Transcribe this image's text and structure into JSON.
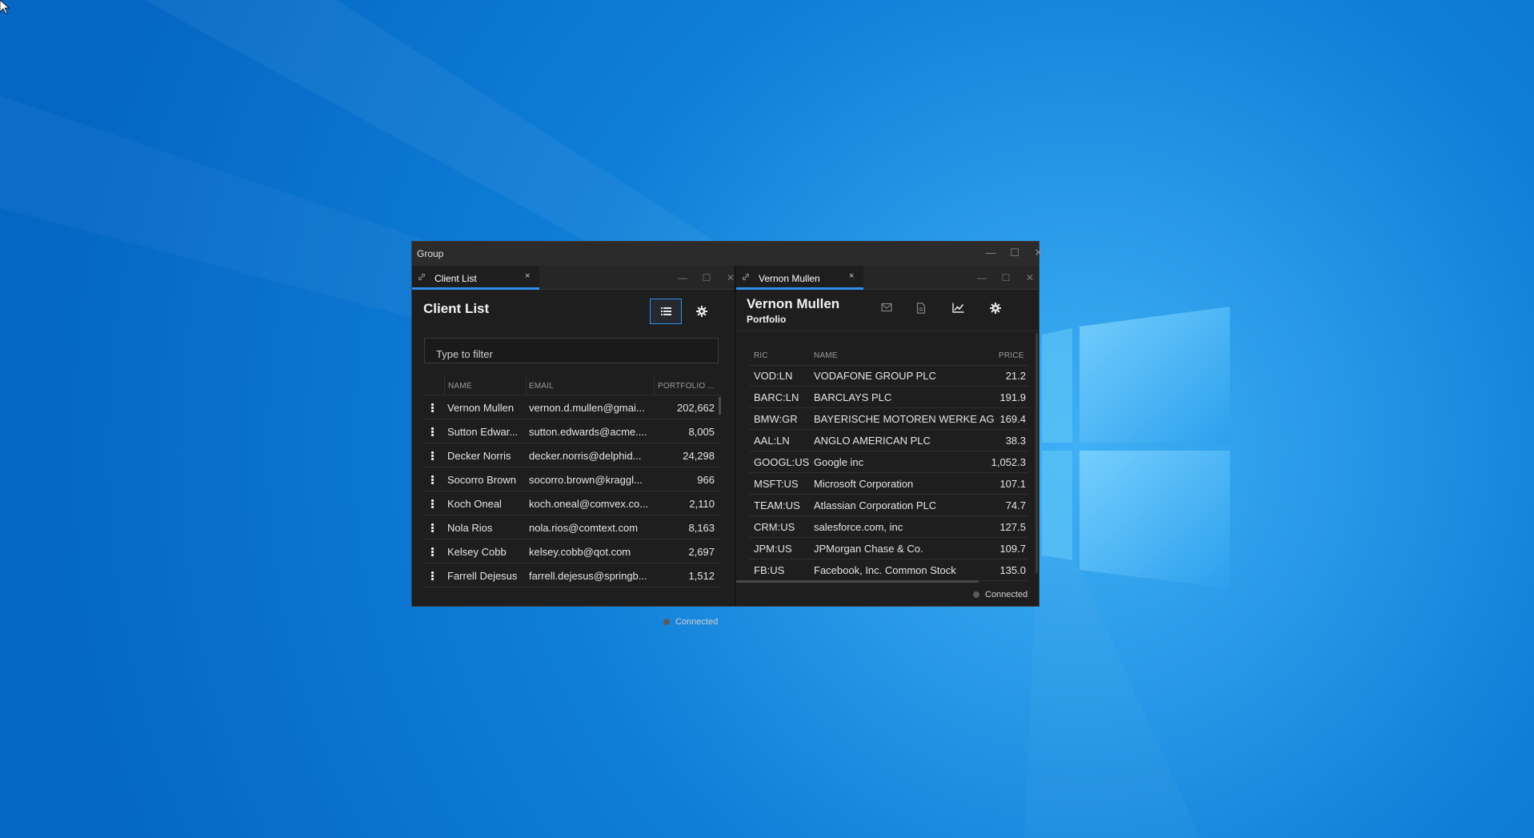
{
  "group_window": {
    "title": "Group",
    "controls": {
      "minimize": "—",
      "maximize": "☐",
      "close": "✕"
    }
  },
  "client_list": {
    "tab": {
      "label": "Client List",
      "close": "×"
    },
    "title": "Client List",
    "filter": {
      "value": "",
      "placeholder": "Type to filter"
    },
    "columns": [
      "NAME",
      "EMAIL",
      "PORTFOLIO ..."
    ],
    "rows": [
      {
        "name": "Vernon Mullen",
        "email": "vernon.d.mullen@gmai...",
        "portfolio": "202,662"
      },
      {
        "name": "Sutton Edwar...",
        "email": "sutton.edwards@acme....",
        "portfolio": "8,005"
      },
      {
        "name": "Decker Norris",
        "email": "decker.norris@delphid...",
        "portfolio": "24,298"
      },
      {
        "name": "Socorro Brown",
        "email": "socorro.brown@kraggl...",
        "portfolio": "966"
      },
      {
        "name": "Koch Oneal",
        "email": "koch.oneal@comvex.co...",
        "portfolio": "2,110"
      },
      {
        "name": "Nola Rios",
        "email": "nola.rios@comtext.com",
        "portfolio": "8,163"
      },
      {
        "name": "Kelsey Cobb",
        "email": "kelsey.cobb@qot.com",
        "portfolio": "2,697"
      },
      {
        "name": "Farrell Dejesus",
        "email": "farrell.dejesus@springb...",
        "portfolio": "1,512"
      }
    ],
    "status": "Connected",
    "icons": {
      "view_toggle": "list-view-icon",
      "settings": "gear-icon"
    }
  },
  "portfolio": {
    "tab": {
      "label": "Vernon Mullen",
      "close": "×"
    },
    "title": "Vernon Mullen",
    "subtitle": "Portfolio",
    "columns": [
      "RIC",
      "NAME",
      "PRICE"
    ],
    "rows": [
      {
        "ric": "VOD:LN",
        "name": "VODAFONE GROUP PLC",
        "price": "21.2"
      },
      {
        "ric": "BARC:LN",
        "name": "BARCLAYS PLC",
        "price": "191.9"
      },
      {
        "ric": "BMW:GR",
        "name": "BAYERISCHE MOTOREN WERKE AG",
        "price": "169.4"
      },
      {
        "ric": "AAL:LN",
        "name": "ANGLO AMERICAN PLC",
        "price": "38.3"
      },
      {
        "ric": "GOOGL:US",
        "name": "Google inc",
        "price": "1,052.3"
      },
      {
        "ric": "MSFT:US",
        "name": "Microsoft Corporation",
        "price": "107.1"
      },
      {
        "ric": "TEAM:US",
        "name": "Atlassian Corporation PLC",
        "price": "74.7"
      },
      {
        "ric": "CRM:US",
        "name": "salesforce.com, inc",
        "price": "127.5"
      },
      {
        "ric": "JPM:US",
        "name": "JPMorgan Chase & Co.",
        "price": "109.7"
      },
      {
        "ric": "FB:US",
        "name": "Facebook, Inc. Common Stock",
        "price": "135.0"
      }
    ],
    "status": "Connected",
    "icons": {
      "email": "mail-icon",
      "document": "document-icon",
      "chart": "line-chart-icon",
      "settings": "gear-icon"
    }
  },
  "colors": {
    "accent": "#2e8fea",
    "desktop": "#0a78d4",
    "panel": "#1e1e1e"
  }
}
